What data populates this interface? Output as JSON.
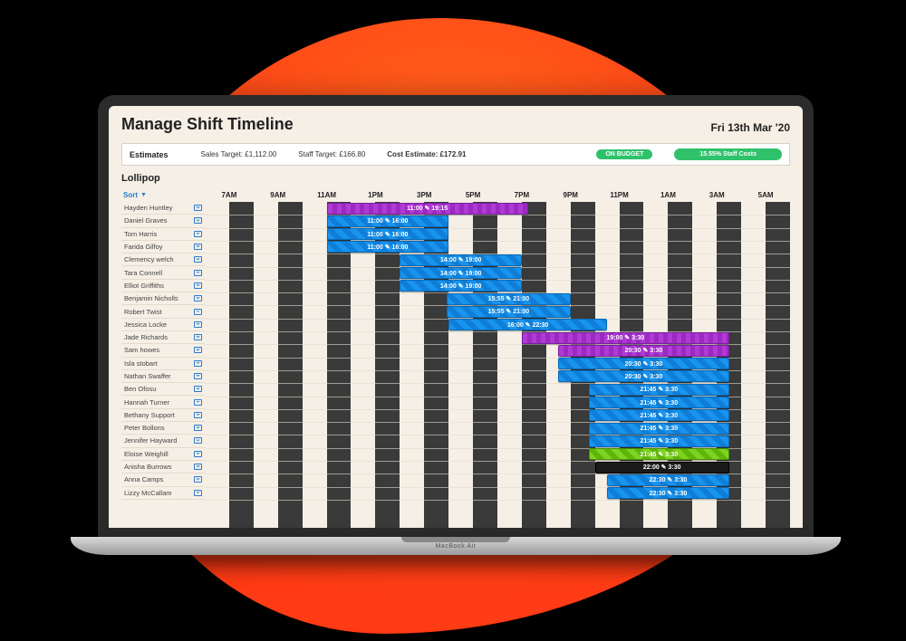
{
  "header": {
    "title": "Manage Shift Timeline",
    "date": "Fri 13th Mar '20"
  },
  "estimates": {
    "label": "Estimates",
    "sales_target": "Sales Target: £1,112.00",
    "staff_target": "Staff Target: £166.80",
    "cost_estimate": "Cost Estimate: £172.91",
    "on_budget": "ON BUDGET",
    "staff_costs": "15.55% Staff Costs"
  },
  "section": "Lollipop",
  "sort_label": "Sort",
  "hours": [
    "7AM",
    "9AM",
    "11AM",
    "1PM",
    "3PM",
    "5PM",
    "7PM",
    "9PM",
    "11PM",
    "1AM",
    "3AM",
    "5AM"
  ],
  "laptop_label": "MacBook Air",
  "staff": [
    {
      "name": "Hayden Huntley",
      "shift": {
        "start": 11.0,
        "end": 19.25,
        "label": "11:00 ✎ 19:15",
        "color": "purple"
      }
    },
    {
      "name": "Daniel Graves",
      "shift": {
        "start": 11.0,
        "end": 16.0,
        "label": "11:00 ✎ 16:00",
        "color": "blue"
      }
    },
    {
      "name": "Tom Harris",
      "shift": {
        "start": 11.0,
        "end": 16.0,
        "label": "11:00 ✎ 16:00",
        "color": "blue"
      }
    },
    {
      "name": "Farida Gilfoy",
      "shift": {
        "start": 11.0,
        "end": 16.0,
        "label": "11:00 ✎ 16:00",
        "color": "blue"
      }
    },
    {
      "name": "Clemency welch",
      "shift": {
        "start": 14.0,
        "end": 19.0,
        "label": "14:00 ✎ 19:00",
        "color": "blue"
      }
    },
    {
      "name": "Tara Connell",
      "shift": {
        "start": 14.0,
        "end": 19.0,
        "label": "14:00 ✎ 19:00",
        "color": "blue"
      }
    },
    {
      "name": "Elliot Griffiths",
      "shift": {
        "start": 14.0,
        "end": 19.0,
        "label": "14:00 ✎ 19:00",
        "color": "blue"
      }
    },
    {
      "name": "Benjamin Nicholls",
      "shift": {
        "start": 15.92,
        "end": 21.0,
        "label": "15:55 ✎ 21:00",
        "color": "blue"
      }
    },
    {
      "name": "Robert Twist",
      "shift": {
        "start": 15.92,
        "end": 21.0,
        "label": "15:55 ✎ 21:00",
        "color": "blue"
      }
    },
    {
      "name": "Jessica Locke",
      "shift": {
        "start": 16.0,
        "end": 22.5,
        "label": "16:00 ✎ 22:30",
        "color": "blue"
      }
    },
    {
      "name": "Jade Richards",
      "shift": {
        "start": 19.0,
        "end": 27.5,
        "label": "19:00 ✎ 3:30",
        "color": "purple"
      }
    },
    {
      "name": "Sam howes",
      "shift": {
        "start": 20.5,
        "end": 27.5,
        "label": "20:30 ✎ 3:30",
        "color": "purple"
      }
    },
    {
      "name": "Isla stobart",
      "shift": {
        "start": 20.5,
        "end": 27.5,
        "label": "20:30 ✎ 3:30",
        "color": "blue"
      }
    },
    {
      "name": "Nathan Swaffer",
      "shift": {
        "start": 20.5,
        "end": 27.5,
        "label": "20:30 ✎ 3:30",
        "color": "blue"
      }
    },
    {
      "name": "Ben Ofosu",
      "shift": {
        "start": 21.75,
        "end": 27.5,
        "label": "21:45 ✎ 3:30",
        "color": "blue"
      }
    },
    {
      "name": "Hannah Turner",
      "shift": {
        "start": 21.75,
        "end": 27.5,
        "label": "21:45 ✎ 3:30",
        "color": "blue"
      }
    },
    {
      "name": "Bethany Support",
      "shift": {
        "start": 21.75,
        "end": 27.5,
        "label": "21:45 ✎ 3:30",
        "color": "blue"
      }
    },
    {
      "name": "Peter Bollons",
      "shift": {
        "start": 21.75,
        "end": 27.5,
        "label": "21:45 ✎ 3:30",
        "color": "blue"
      }
    },
    {
      "name": "Jennifer Hayward",
      "shift": {
        "start": 21.75,
        "end": 27.5,
        "label": "21:45 ✎ 3:30",
        "color": "blue"
      }
    },
    {
      "name": "Eloise Weighill",
      "shift": {
        "start": 21.75,
        "end": 27.5,
        "label": "21:45 ✎ 3:30",
        "color": "green"
      }
    },
    {
      "name": "Anisha Burrows",
      "shift": {
        "start": 22.0,
        "end": 27.5,
        "label": "22:00 ✎ 3:30",
        "color": "black"
      }
    },
    {
      "name": "Anna Camps",
      "shift": {
        "start": 22.5,
        "end": 27.5,
        "label": "22:30 ✎ 3:30",
        "color": "blue"
      }
    },
    {
      "name": "Lizzy McCallam",
      "shift": {
        "start": 22.5,
        "end": 27.5,
        "label": "22:30 ✎ 3:30",
        "color": "blue"
      }
    }
  ],
  "timeline_range": {
    "start": 6,
    "end": 30
  }
}
